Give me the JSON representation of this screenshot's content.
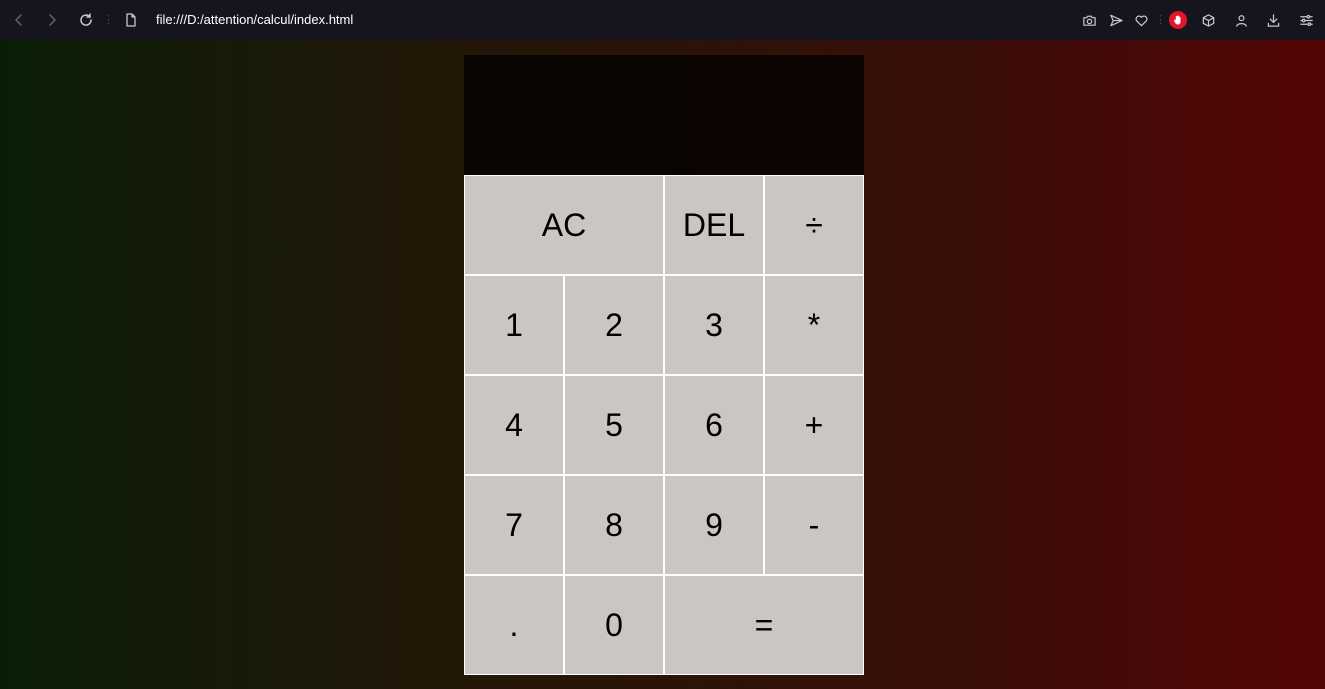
{
  "browser": {
    "url": "file:///D:/attention/calcul/index.html",
    "icons": [
      "back-icon",
      "forward-icon",
      "reload-icon",
      "file-icon",
      "camera-icon",
      "send-icon",
      "heart-icon",
      "adblock-icon",
      "cube-icon",
      "profile-icon",
      "download-icon",
      "settings-icon"
    ]
  },
  "calculator": {
    "previous_operand": "",
    "current_operand": "",
    "keys": {
      "ac": "AC",
      "del": "DEL",
      "divide": "÷",
      "one": "1",
      "two": "2",
      "three": "3",
      "multiply": "*",
      "four": "4",
      "five": "5",
      "six": "6",
      "plus": "+",
      "seven": "7",
      "eight": "8",
      "nine": "9",
      "minus": "-",
      "dot": ".",
      "zero": "0",
      "equals": "="
    }
  },
  "colors": {
    "toolbar": "#16141f",
    "key_bg": "#cbc5c4",
    "gradient_left": "#0a1e07",
    "gradient_right": "#540506",
    "adblock": "#e0162b"
  }
}
